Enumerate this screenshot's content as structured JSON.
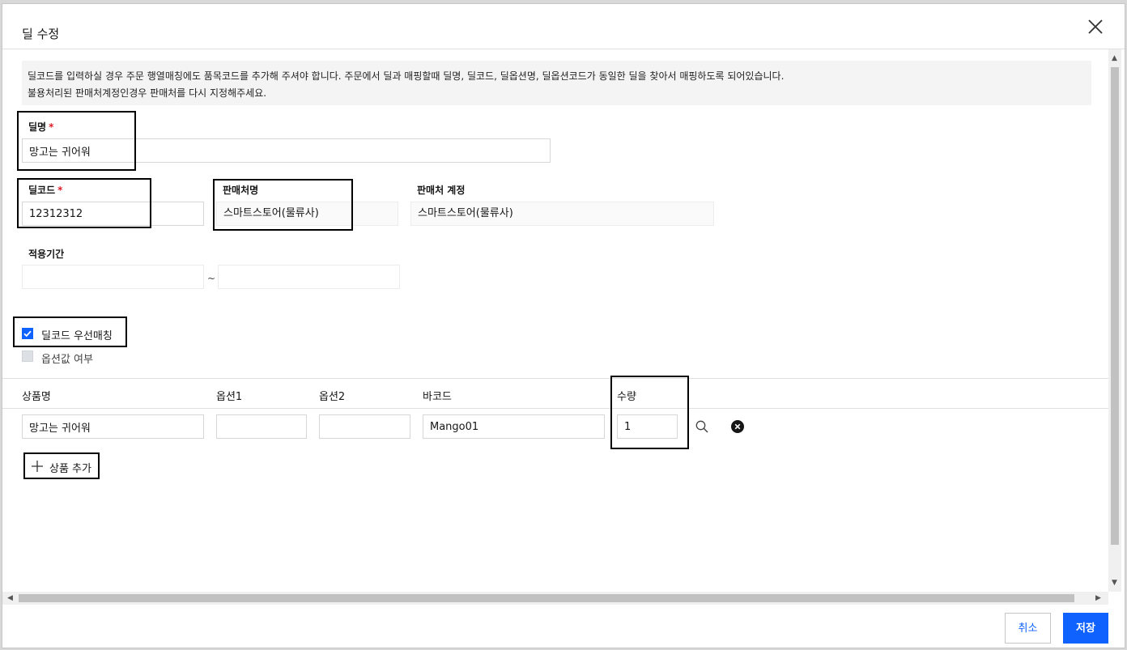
{
  "modal": {
    "title": "딜 수정",
    "close_icon": "close-icon"
  },
  "notice": {
    "line1": "딜코드를 입력하실 경우 주문 행열매칭에도 품목코드를 추가해 주셔야 합니다. 주문에서 딜과 매핑할때 딜명, 딜코드, 딜옵션명, 딜옵션코드가 동일한 딜을 찾아서 매핑하도록 되어있습니다.",
    "line2": "불용처리된 판매처계정인경우 판매처를 다시 지정해주세요."
  },
  "form": {
    "deal_name": {
      "label": "딜명",
      "required_mark": "*",
      "value": "망고는 귀어워"
    },
    "deal_code": {
      "label": "딜코드",
      "required_mark": "*",
      "value": "12312312"
    },
    "seller_name": {
      "label": "판매처명",
      "value": "스마트스토어(물류사)"
    },
    "seller_account": {
      "label": "판매처 계정",
      "value": "스마트스토어(물류사)"
    },
    "period": {
      "label": "적용기간",
      "start": "",
      "separator": "~",
      "end": ""
    }
  },
  "options": {
    "priority_match": {
      "label": "딜코드 우선매칭",
      "checked": true
    },
    "option_value": {
      "label": "옵션값 여부",
      "checked": false
    }
  },
  "products": {
    "headers": {
      "name": "상품명",
      "option1": "옵션1",
      "option2": "옵션2",
      "barcode": "바코드",
      "qty": "수량"
    },
    "rows": [
      {
        "name": "망고는 귀어워",
        "option1": "",
        "option2": "",
        "barcode": "Mango01",
        "qty": "1"
      }
    ],
    "add_label": "상품 추가"
  },
  "footer": {
    "cancel_label": "취소",
    "save_label": "저장"
  },
  "colors": {
    "primary": "#0f62fe",
    "required": "#da1e28",
    "annotation_box": "#000000"
  }
}
